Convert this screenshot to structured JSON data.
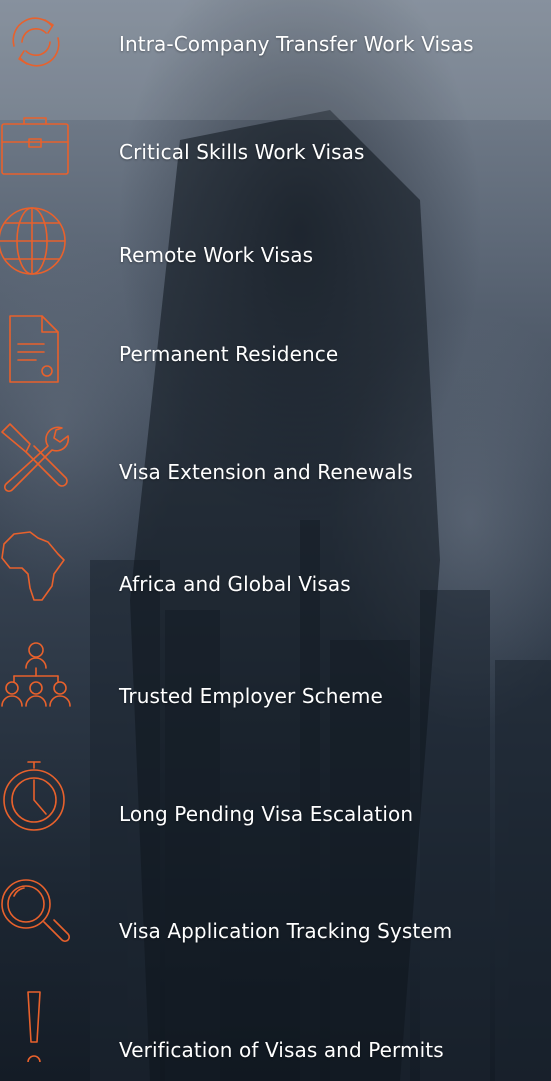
{
  "accent_color": "#e8612c",
  "services": [
    {
      "label": "Intra-Company Transfer Work Visas",
      "icon": "refresh-icon"
    },
    {
      "label": "Critical Skills Work Visas",
      "icon": "briefcase-icon"
    },
    {
      "label": "Remote Work Visas",
      "icon": "globe-icon"
    },
    {
      "label": "Permanent Residence",
      "icon": "document-icon"
    },
    {
      "label": "Visa Extension and Renewals",
      "icon": "tools-icon"
    },
    {
      "label": "Africa and Global Visas",
      "icon": "africa-map-icon"
    },
    {
      "label": "Trusted Employer Scheme",
      "icon": "team-hierarchy-icon"
    },
    {
      "label": "Long Pending Visa Escalation",
      "icon": "stopwatch-icon"
    },
    {
      "label": "Visa Application Tracking System",
      "icon": "magnifier-icon"
    },
    {
      "label": "Verification of Visas and Permits",
      "icon": "exclamation-icon"
    }
  ]
}
